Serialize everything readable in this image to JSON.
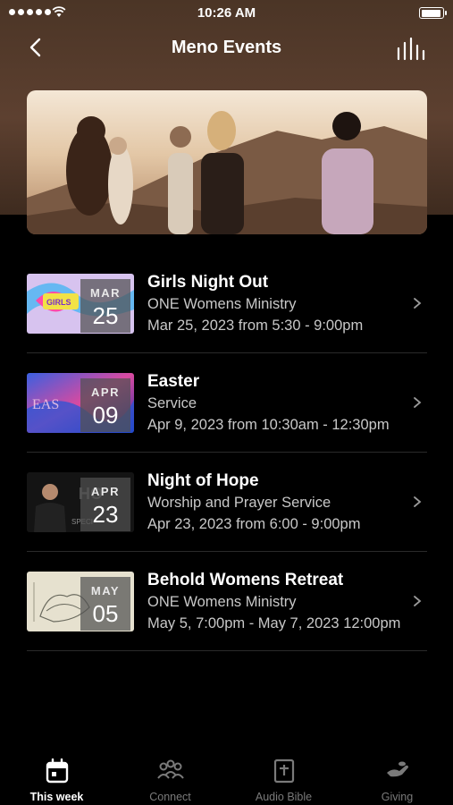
{
  "status": {
    "time": "10:26 AM"
  },
  "nav": {
    "title": "Meno Events"
  },
  "events": [
    {
      "title": "Girls Night Out",
      "subtitle": "ONE Womens Ministry",
      "when": "Mar 25, 2023 from 5:30 - 9:00pm",
      "month": "MAR",
      "day": "25"
    },
    {
      "title": "Easter",
      "subtitle": "Service",
      "when": "Apr 9, 2023 from 10:30am - 12:30pm",
      "month": "APR",
      "day": "09"
    },
    {
      "title": "Night of Hope",
      "subtitle": "Worship and Prayer Service",
      "when": "Apr 23, 2023 from 6:00 - 9:00pm",
      "month": "APR",
      "day": "23"
    },
    {
      "title": "Behold Womens Retreat",
      "subtitle": "ONE Womens Ministry",
      "when": "May 5, 7:00pm - May 7, 2023 12:00pm",
      "month": "MAY",
      "day": "05"
    }
  ],
  "tabs": [
    {
      "label": "This week",
      "icon": "calendar-icon"
    },
    {
      "label": "Connect",
      "icon": "people-icon"
    },
    {
      "label": "Audio Bible",
      "icon": "bible-icon"
    },
    {
      "label": "Giving",
      "icon": "giving-hand-icon"
    }
  ],
  "colors": {
    "header_brown": "#5d4030",
    "background": "#000000",
    "muted_text": "#c8c8c8",
    "inactive_tab": "#7a7a7a"
  }
}
